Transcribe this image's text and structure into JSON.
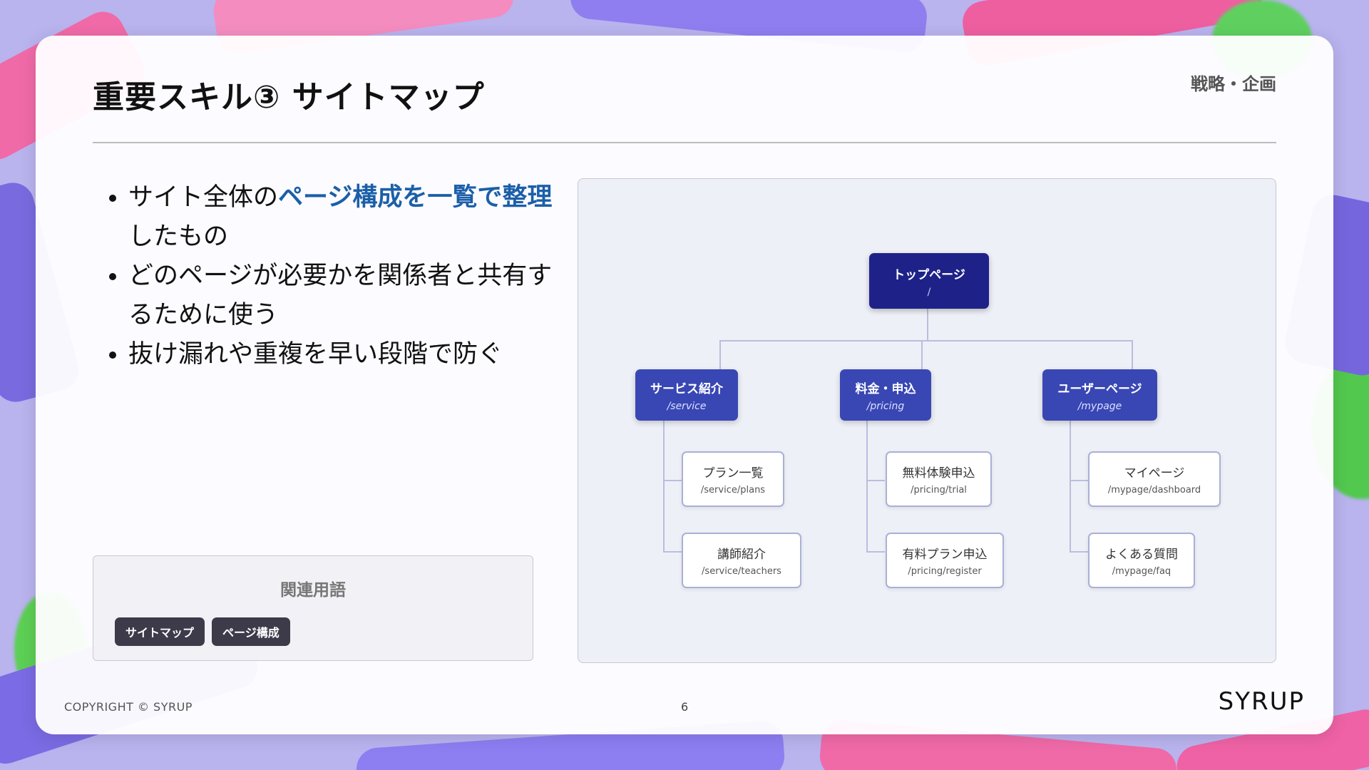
{
  "slide": {
    "title": "重要スキル③ サイトマップ",
    "category": "戦略・企画",
    "bullets": [
      {
        "pre": "サイト全体の",
        "highlight": "ページ構成を一覧で整理",
        "post": "したもの"
      },
      {
        "pre": "どのページが必要かを関係者と共有するために使う",
        "highlight": "",
        "post": ""
      },
      {
        "pre": "抜け漏れや重複を早い段階で防ぐ",
        "highlight": "",
        "post": ""
      }
    ],
    "related": {
      "title": "関連用語",
      "tags": [
        "サイトマップ",
        "ページ構成"
      ]
    },
    "sitemap": {
      "root": {
        "label": "トップページ",
        "path": "/"
      },
      "sections": [
        {
          "label": "サービス紹介",
          "path": "/service",
          "children": [
            {
              "label": "プラン一覧",
              "path": "/service/plans"
            },
            {
              "label": "講師紹介",
              "path": "/service/teachers"
            }
          ]
        },
        {
          "label": "料金・申込",
          "path": "/pricing",
          "children": [
            {
              "label": "無料体験申込",
              "path": "/pricing/trial"
            },
            {
              "label": "有料プラン申込",
              "path": "/pricing/register"
            }
          ]
        },
        {
          "label": "ユーザーページ",
          "path": "/mypage",
          "children": [
            {
              "label": "マイページ",
              "path": "/mypage/dashboard"
            },
            {
              "label": "よくある質問",
              "path": "/mypage/faq"
            }
          ]
        }
      ]
    },
    "footer": {
      "copyright": "COPYRIGHT © SYRUP",
      "page_number": "6",
      "logo": "SYRUP"
    }
  },
  "colors": {
    "accent": "#1b5fa8",
    "root_node": "#1e2288",
    "section_node": "#3947b4",
    "tag_bg": "#3d3a4a"
  }
}
